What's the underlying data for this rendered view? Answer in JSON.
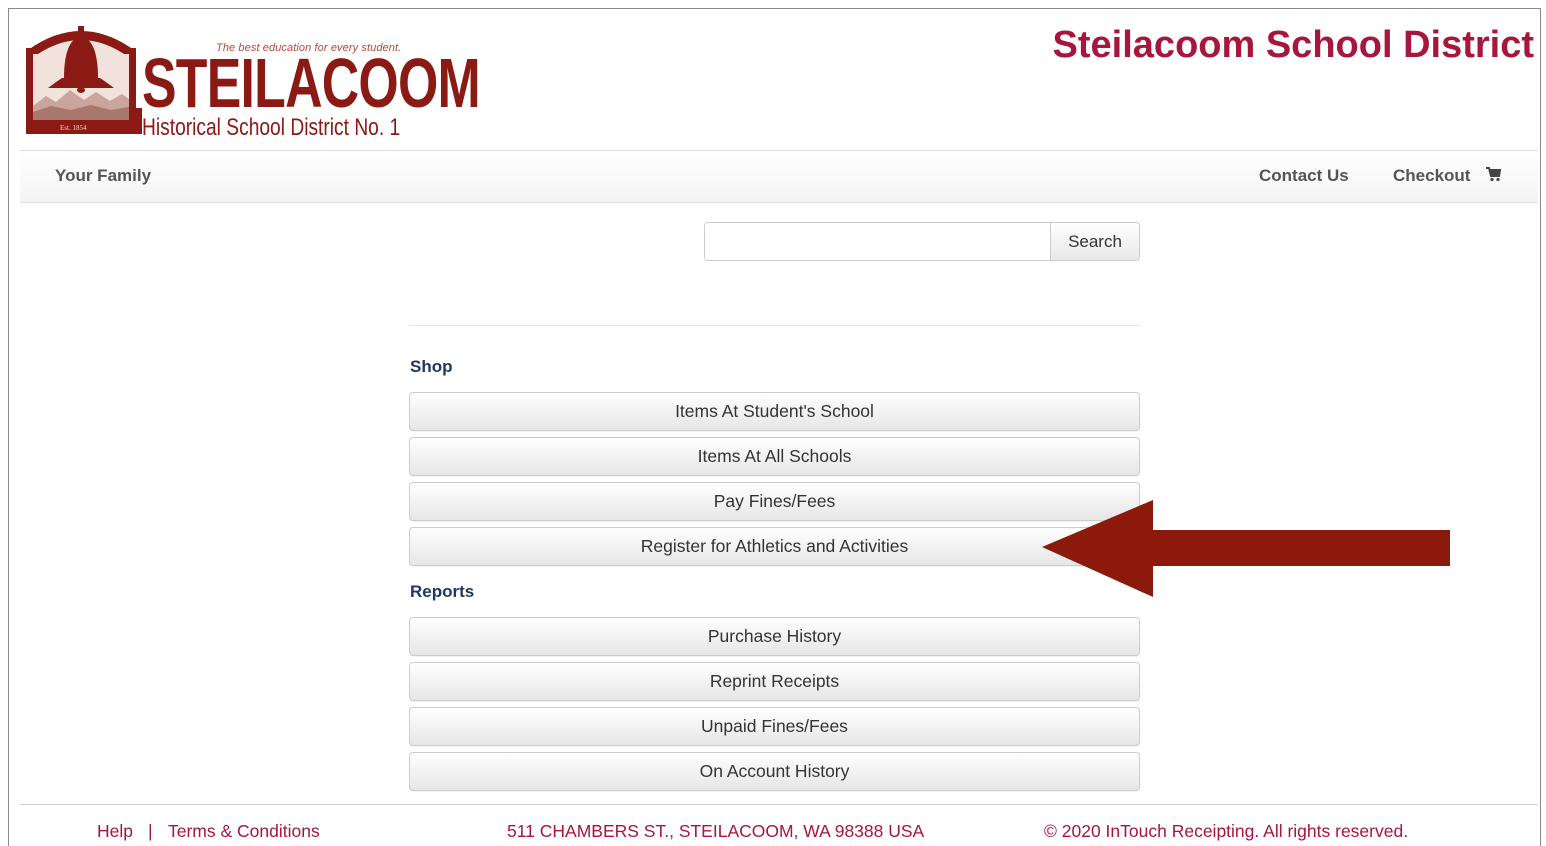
{
  "header": {
    "logo": {
      "tagline": "The best education for every student.",
      "wordmark": "STEILACOOM",
      "subtitle": "Historical School District No. 1",
      "established": "Est. 1854"
    },
    "site_title": "Steilacoom School District"
  },
  "nav": {
    "family": "Your Family",
    "contact": "Contact Us",
    "checkout": "Checkout",
    "cart_icon": "shopping-cart-icon"
  },
  "search": {
    "value": "",
    "placeholder": "",
    "button_label": "Search"
  },
  "shop": {
    "heading": "Shop",
    "items": [
      "Items At Student's School",
      "Items At All Schools",
      "Pay Fines/Fees",
      "Register for Athletics and Activities"
    ]
  },
  "reports": {
    "heading": "Reports",
    "items": [
      "Purchase History",
      "Reprint Receipts",
      "Unpaid Fines/Fees",
      "On Account History"
    ]
  },
  "annotation": {
    "arrow_color": "#8b1a0c",
    "points_to": "Register for Athletics and Activities"
  },
  "footer": {
    "help": "Help",
    "separator": "|",
    "terms": "Terms & Conditions",
    "address": "511 CHAMBERS ST., STEILACOOM, WA 98388 USA",
    "copyright": "© 2020 InTouch Receipting. All rights reserved."
  },
  "colors": {
    "brand_red": "#a7163d",
    "logo_red": "#8b1a14",
    "heading_navy": "#1f3864"
  }
}
